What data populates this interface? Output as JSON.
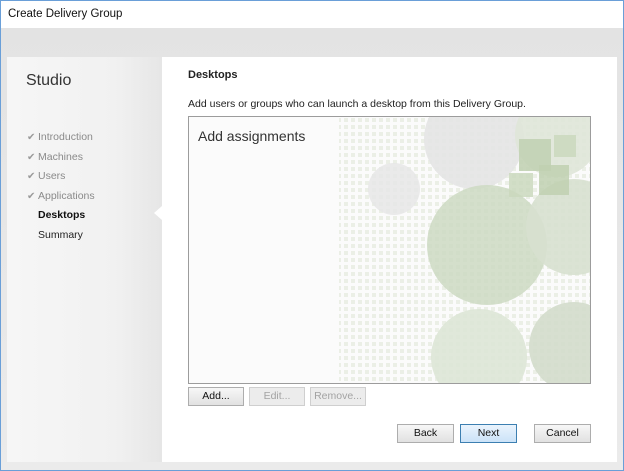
{
  "window": {
    "title": "Create Delivery Group"
  },
  "sidebar": {
    "heading": "Studio",
    "steps": [
      {
        "label": "Introduction",
        "state": "done"
      },
      {
        "label": "Machines",
        "state": "done"
      },
      {
        "label": "Users",
        "state": "done"
      },
      {
        "label": "Applications",
        "state": "done"
      },
      {
        "label": "Desktops",
        "state": "current"
      },
      {
        "label": "Summary",
        "state": "pending"
      }
    ]
  },
  "main": {
    "title": "Desktops",
    "description": "Add users or groups who can launch a desktop from this Delivery Group.",
    "assignments_heading": "Add assignments",
    "list_buttons": {
      "add": "Add...",
      "edit": "Edit...",
      "remove": "Remove..."
    }
  },
  "footer": {
    "back": "Back",
    "next": "Next",
    "cancel": "Cancel"
  },
  "colors": {
    "accent": "#3c7fb1",
    "watermark": "#c9d6bd"
  },
  "icons": {
    "done_step": "check-icon"
  }
}
